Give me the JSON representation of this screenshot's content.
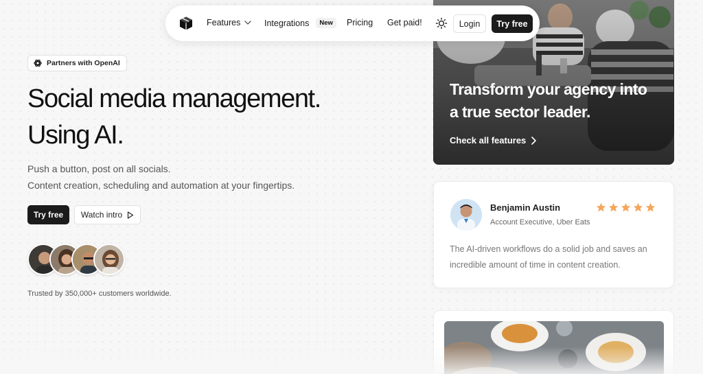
{
  "nav": {
    "logo_icon": "box-cube-icon",
    "items": [
      {
        "label": "Features",
        "has_dropdown": true
      },
      {
        "label": "Integrations",
        "badge": "New"
      },
      {
        "label": "Pricing"
      },
      {
        "label": "Get paid!"
      }
    ],
    "theme_icon": "sun-icon",
    "login_label": "Login",
    "try_free_label": "Try free"
  },
  "hero": {
    "badge_label": "Partners with OpenAI",
    "badge_icon": "openai-logo-icon",
    "headline_line1": "Social media management.",
    "headline_line2": "Using AI.",
    "subtext_line1": "Push a button, post on all socials.",
    "subtext_line2": "Content creation, scheduling and automation at your fingertips.",
    "primary_button": "Try free",
    "secondary_button": "Watch intro",
    "trust_text": "Trusted by 350,000+ customers worldwide."
  },
  "feature_card": {
    "title": "Transform your agency into a true sector leader.",
    "link_label": "Check all features"
  },
  "testimonial": {
    "name": "Benjamin Austin",
    "role": "Account Executive, Uber Eats",
    "rating": 5,
    "max_rating": 5,
    "quote": "The AI-driven workflows do a solid job and saves an incredible amount of time in content creation."
  },
  "colors": {
    "primary_dark": "#1b1b1b",
    "star": "#f5a65b",
    "page_bg": "#f7f7f7"
  }
}
